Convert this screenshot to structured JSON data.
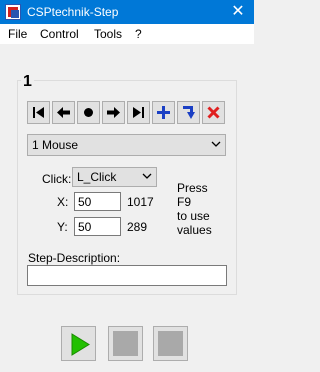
{
  "window": {
    "title": "CSPtechnik-Step",
    "close_glyph": "✕"
  },
  "menu": [
    "File",
    "Control",
    "Tools",
    "?"
  ],
  "step": {
    "number": "1"
  },
  "toolbar": {
    "icons": [
      "first-step-icon",
      "previous-step-icon",
      "record-icon",
      "next-step-icon",
      "last-step-icon",
      "add-step-icon",
      "insert-step-icon",
      "delete-step-icon"
    ],
    "accent": "#1a3fc4",
    "delete_color": "#e02020"
  },
  "action_select": {
    "value": "1 Mouse"
  },
  "click": {
    "label": "Click:",
    "value": "L_Click"
  },
  "x": {
    "label": "X:",
    "value": "50",
    "current": "1017"
  },
  "y": {
    "label": "Y:",
    "value": "50",
    "current": "289"
  },
  "hint": {
    "lines": [
      "Press",
      "F9",
      "to use",
      "values"
    ]
  },
  "description": {
    "label": "Step-Description:",
    "value": ""
  },
  "controls": {
    "play_color": "#22c000"
  }
}
